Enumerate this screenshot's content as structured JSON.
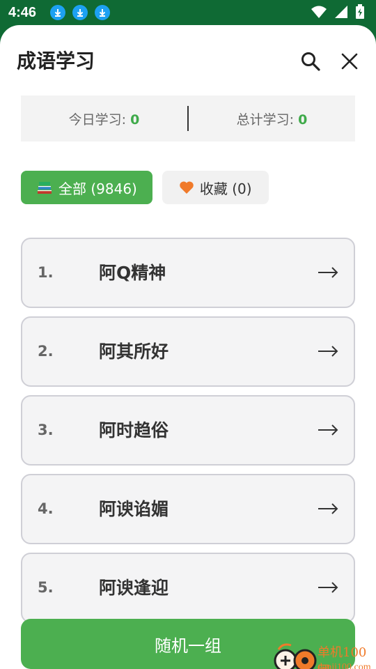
{
  "status_bar": {
    "time": "4:46",
    "icons": [
      "download-icon",
      "download-icon",
      "download-icon",
      "wifi-icon",
      "signal-icon",
      "battery-icon"
    ]
  },
  "header": {
    "title": "成语学习",
    "search_icon": "search-icon",
    "close_icon": "close-icon"
  },
  "stats": {
    "today_label": "今日学习: ",
    "today_value": "0",
    "total_label": "总计学习: ",
    "total_value": "0"
  },
  "filters": {
    "all_label": "全部 (9846)",
    "fav_label": "收藏 (0)",
    "all_icon": "books-icon",
    "fav_icon": "heart-icon"
  },
  "list": [
    {
      "num": "1.",
      "text": "阿Q精神"
    },
    {
      "num": "2.",
      "text": "阿其所好"
    },
    {
      "num": "3.",
      "text": "阿时趋俗"
    },
    {
      "num": "4.",
      "text": "阿谀谄媚"
    },
    {
      "num": "5.",
      "text": "阿谀逢迎"
    }
  ],
  "random_button": "随机一组",
  "watermark": {
    "cn": "单机100网",
    "en": "danji100.com"
  },
  "colors": {
    "status_bg": "#0f6a34",
    "accent": "#4caf50",
    "stat_number": "#3faa4a",
    "heart": "#f07a2a"
  }
}
